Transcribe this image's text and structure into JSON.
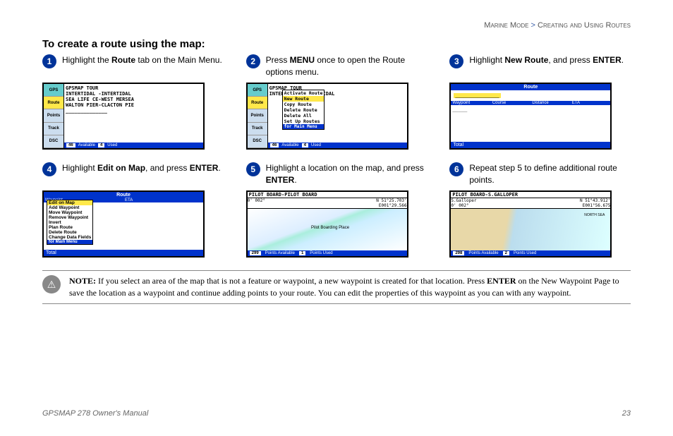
{
  "breadcrumb": {
    "a": "Marine Mode",
    "sep": ">",
    "b": "Creating and Using Routes"
  },
  "heading": "To create a route using the map:",
  "steps": {
    "s1": {
      "num": "1",
      "t1": "Highlight the ",
      "b": "Route",
      "t2": " tab on the Main Menu."
    },
    "s2": {
      "num": "2",
      "t1": "Press ",
      "b": "MENU",
      "t2": " once to open the Route options menu."
    },
    "s3": {
      "num": "3",
      "t1": "Highlight ",
      "b": "New Route",
      "t2": ", and press ",
      "b2": "ENTER",
      "t3": "."
    },
    "s4": {
      "num": "4",
      "t1": "Highlight ",
      "b": "Edit on Map",
      "t2": ", and press ",
      "b2": "ENTER",
      "t3": "."
    },
    "s5": {
      "num": "5",
      "t1": "Highlight a location on the map, and press ",
      "b": "ENTER",
      "t2": "."
    },
    "s6": {
      "num": "6",
      "t1": "Repeat step 5 to define additional route points."
    }
  },
  "scr1": {
    "tabs": [
      "GPS",
      "Route",
      "Points",
      "Track",
      "DSC"
    ],
    "lines": [
      "GPSMAP TOUR",
      "INTERTIDAL -INTERTIDAL",
      "SEA LIFE CE-WEST MERSEA",
      "WALTON PIER-CLACTON PIE",
      "______________"
    ],
    "avail": "46",
    "availL": "Available",
    "used": "4",
    "usedL": "Used"
  },
  "scr2": {
    "menu": [
      "Activate Route",
      "New Route",
      "Copy Route",
      "Delete Route",
      "Delete All",
      "Set Up Routes"
    ],
    "menuFt": "for Main Menu"
  },
  "scr3": {
    "title": "Route",
    "cols": [
      "Waypoint",
      "Course",
      "Distance",
      "ETA"
    ],
    "total": "Total"
  },
  "scr4": {
    "menu": [
      "Edit on Map",
      "Add Waypoint",
      "Move Waypoint",
      "Remove Waypoint",
      "Invert",
      "Plan Route",
      "Delete Route",
      "Change Data Fields"
    ],
    "menuFt": "for Main Menu"
  },
  "scr5": {
    "title": "PILOT BOARD-PILOT BOARD",
    "lat": "N 51°25.703'",
    "lon": "E001°29.566",
    "brg": "002°",
    "dist": "0'",
    "ptsAvail": "299",
    "ptsAvailL": "Points Available",
    "ptsUsed": "1",
    "ptsUsedL": "Points Used",
    "label": "Pilot Boarding Place"
  },
  "scr6": {
    "title": "PILOT BOARD-S.GALLOPER",
    "lat": "N 51°43.912'",
    "lon": "E001°56.675",
    "brg": "002°",
    "dist": "0'",
    "loc": "S.Galloper",
    "ptsAvail": "298",
    "ptsAvailL": "Points Available",
    "ptsUsed": "2",
    "ptsUsedL": "Points Used"
  },
  "note": {
    "label": "NOTE:",
    "t1": " If you select an area of the map that is not a feature or waypoint, a new waypoint is created for that location. Press ",
    "b": "ENTER",
    "t2": " on the New Waypoint Page to save the location as a waypoint and continue adding points to your route. You can edit the properties of this waypoint as you can with any waypoint."
  },
  "footer": {
    "left": "GPSMAP 278 Owner's Manual",
    "right": "23"
  }
}
